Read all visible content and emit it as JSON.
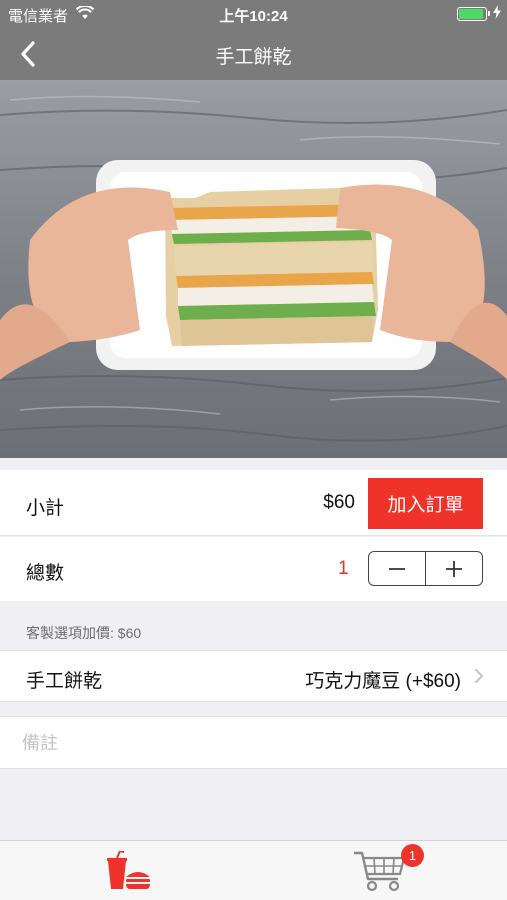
{
  "status_bar": {
    "carrier": "電信業者",
    "time": "上午10:24",
    "battery_level": 0.95
  },
  "nav": {
    "title": "手工餅乾",
    "back_icon": "chevron-left-icon"
  },
  "hero": {
    "icon": "sandwich-photo"
  },
  "order": {
    "subtotal_label": "小計",
    "subtotal_value": "$60",
    "add_button": "加入訂單",
    "quantity_label": "總數",
    "quantity_value": "1"
  },
  "custom": {
    "header": "客製選項加價: $60",
    "option_label": "手工餅乾",
    "option_value": "巧克力魔豆 (+$60)"
  },
  "note": {
    "placeholder": "備註",
    "value": ""
  },
  "tabbar": {
    "tabs": [
      {
        "name": "menu",
        "icon": "drink-burger-icon",
        "active": true
      },
      {
        "name": "cart",
        "icon": "cart-icon",
        "badge": "1"
      }
    ],
    "accent": "#f0332a"
  },
  "colors": {
    "nav": "#7b7b7b",
    "accent": "#f0332a",
    "quantity": "#e9332b"
  }
}
